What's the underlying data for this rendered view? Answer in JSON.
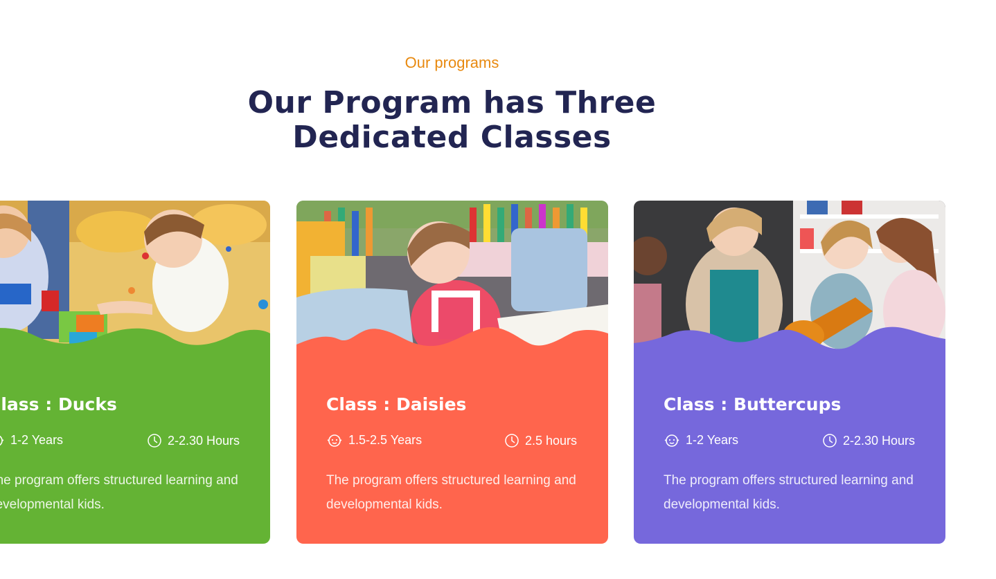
{
  "section": {
    "eyebrow": "Our programs",
    "heading_line1": "Our Program has Three",
    "heading_line2": "Dedicated Classes"
  },
  "cards": [
    {
      "title": "Class : Ducks",
      "age": "1-2 Years",
      "duration": "2-2.30 Hours",
      "description": "The program offers structured learning and developmental kids.",
      "color": "#64b334",
      "age_icon": "baby-face-icon",
      "time_icon": "clock-icon"
    },
    {
      "title": "Class : Daisies",
      "age": "1.5-2.5 Years",
      "duration": "2.5 hours",
      "description": "The program offers structured learning and developmental kids.",
      "color": "#ff654d",
      "age_icon": "baby-face-icon",
      "time_icon": "clock-icon"
    },
    {
      "title": "Class : Buttercups",
      "age": "1-2 Years",
      "duration": "2-2.30 Hours",
      "description": "The program offers structured learning and developmental kids.",
      "color": "#7668dc",
      "age_icon": "baby-face-icon",
      "time_icon": "clock-icon"
    }
  ]
}
